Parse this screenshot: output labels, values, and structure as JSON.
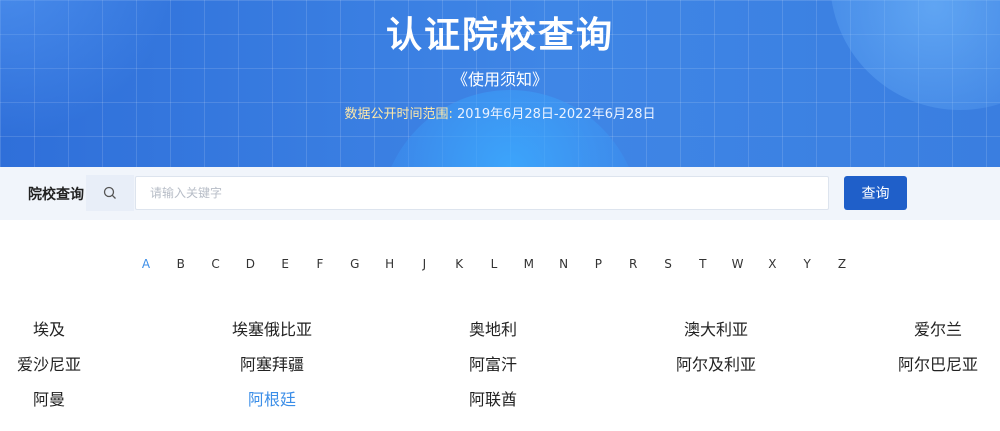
{
  "banner": {
    "title": "认证院校查询",
    "notice": "《使用须知》",
    "range_label": "数据公开时间范围:",
    "range_value": "2019年6月28日-2022年6月28日"
  },
  "search": {
    "label": "院校查询",
    "placeholder": "请输入关键字",
    "value": "",
    "button_label": "查询",
    "icon": "search-icon"
  },
  "alphabet": {
    "letters": [
      "A",
      "B",
      "C",
      "D",
      "E",
      "F",
      "G",
      "H",
      "J",
      "K",
      "L",
      "M",
      "N",
      "P",
      "R",
      "S",
      "T",
      "W",
      "X",
      "Y",
      "Z"
    ],
    "active": "A"
  },
  "countries": {
    "rows": [
      [
        "埃及",
        "埃塞俄比亚",
        "奥地利",
        "澳大利亚",
        "爱尔兰"
      ],
      [
        "爱沙尼亚",
        "阿塞拜疆",
        "阿富汗",
        "阿尔及利亚",
        "阿尔巴尼亚"
      ],
      [
        "阿曼",
        "阿根廷",
        "阿联酋"
      ]
    ],
    "active": "阿根廷"
  },
  "colors": {
    "banner": "#3a7ee0",
    "primary_button": "#1f5fc9",
    "active_text": "#3b8ee8"
  }
}
